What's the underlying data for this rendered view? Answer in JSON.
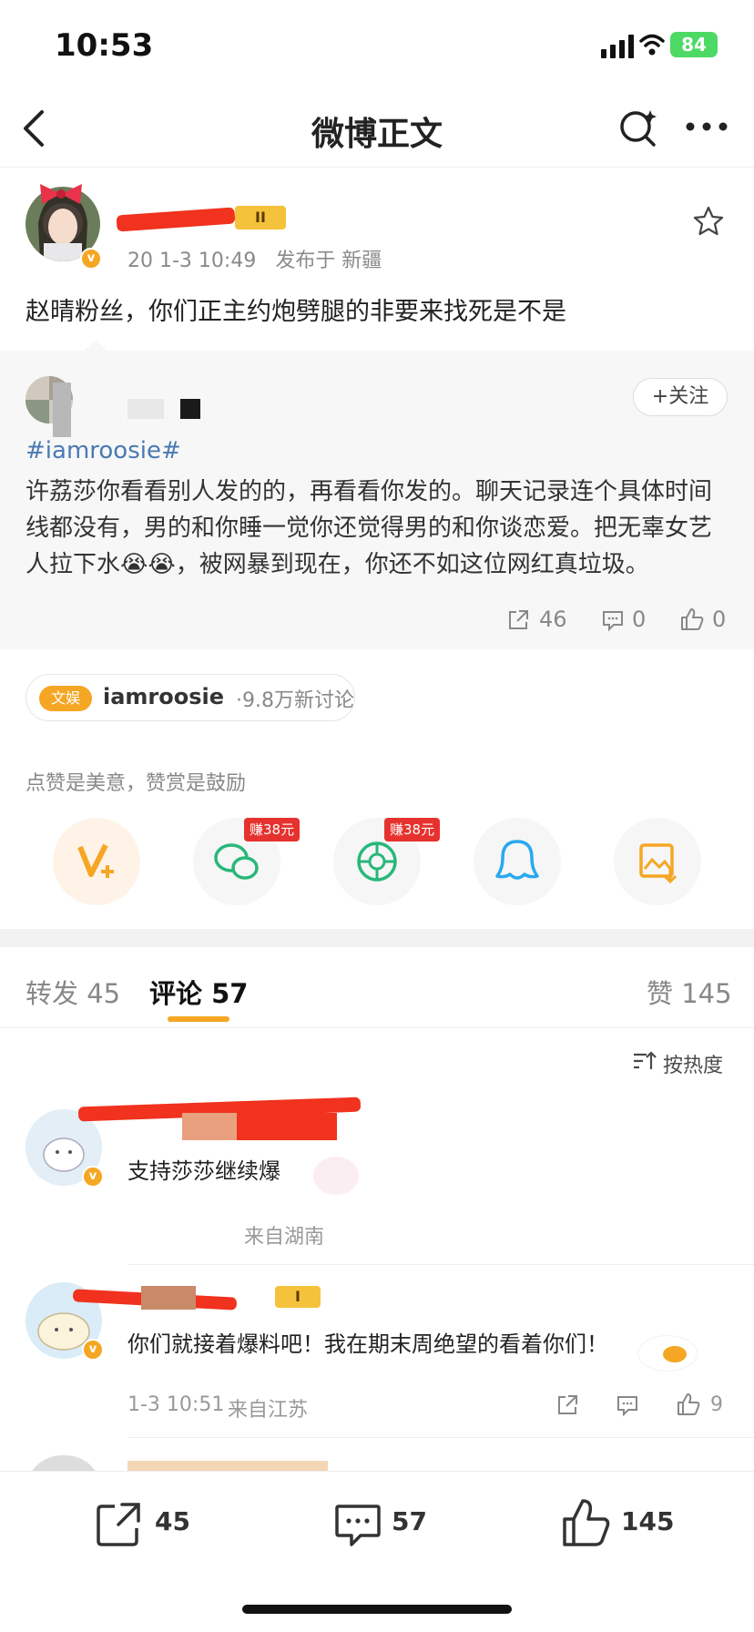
{
  "status_bar": {
    "time": "10:53",
    "battery": "84"
  },
  "nav": {
    "title": "微博正文"
  },
  "post": {
    "date": "20 1-3 10:49",
    "location": "发布于 新疆",
    "text": "赵晴粉丝，你们正主约炮劈腿的非要来找死是不是",
    "level": "II"
  },
  "repost": {
    "follow_label": "+关注",
    "hashtag": "#iamroosie#",
    "lines": [
      "许荔莎你看看别人发的的，再看看你发的。聊天记录连个具体时间",
      "线都没有，男的和你睡一觉你还觉得男的和你谈恋爱。把无辜女艺",
      "人拉下水😭😭，被网暴到现在，你还不如这位网红真垃圾。"
    ],
    "share_count": "46",
    "comment_count": "0",
    "like_count": "0"
  },
  "topic": {
    "tag": "文娱",
    "name": "iamroosie",
    "count": "·9.8万新讨论"
  },
  "tip": "点赞是美意，赞赏是鼓励",
  "share_targets": [
    {
      "name": "v-plus-icon"
    },
    {
      "name": "wechat-icon",
      "earn": "赚38元"
    },
    {
      "name": "moments-icon",
      "earn": "赚38元"
    },
    {
      "name": "qq-icon"
    },
    {
      "name": "save-image-icon"
    }
  ],
  "tabs": {
    "repost": "转发 45",
    "comment_label": "评论",
    "comment_count": "57",
    "like": "赞 145"
  },
  "sort_label": "按热度",
  "comments": [
    {
      "text": "支持莎莎继续爆",
      "meta": "来自湖南"
    },
    {
      "text": "你们就接着爆料吧！我在期末周绝望的看着你们！",
      "time": "1-3 10:51",
      "location": "来自江苏",
      "like": "9",
      "level": "I"
    }
  ],
  "bottom_bar": {
    "repost": "45",
    "comment": "57",
    "like": "145"
  },
  "colors": {
    "accent": "#f5a623",
    "link": "#4a79b3",
    "redaction": "#f0321e"
  }
}
